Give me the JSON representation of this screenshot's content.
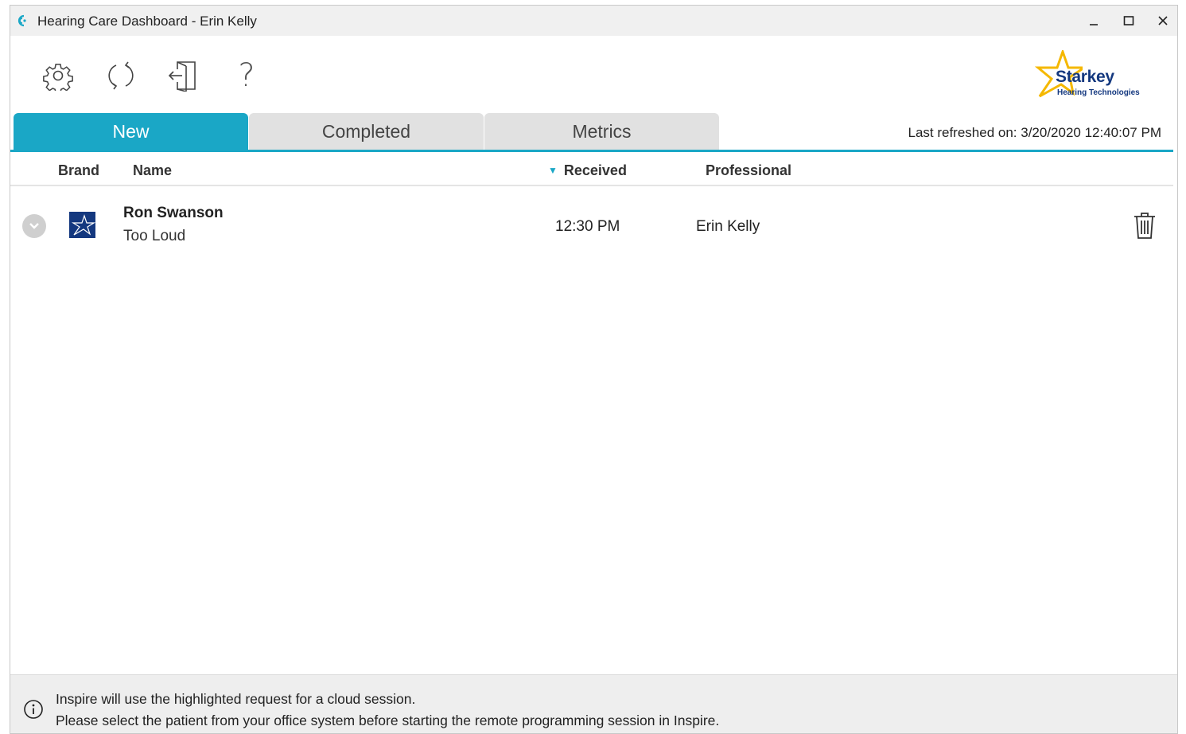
{
  "window": {
    "title": "Hearing Care Dashboard - Erin Kelly",
    "minimize_icon": "minimize-icon",
    "maximize_icon": "maximize-icon",
    "close_icon": "close-icon"
  },
  "toolbar": {
    "icons": [
      "gear-icon",
      "refresh-icon",
      "exit-door-icon",
      "question-mark-icon"
    ],
    "help_label": "?"
  },
  "logo": {
    "name": "Starkey",
    "subtitle": "Hearing Technologies"
  },
  "tabs": [
    {
      "label": "New",
      "active": true
    },
    {
      "label": "Completed",
      "active": false
    },
    {
      "label": "Metrics",
      "active": false
    }
  ],
  "last_refreshed": "Last refreshed on: 3/20/2020 12:40:07 PM",
  "columns": {
    "brand": "Brand",
    "name": "Name",
    "received": "Received",
    "professional": "Professional"
  },
  "rows": [
    {
      "name": "Ron Swanson",
      "issue": "Too Loud",
      "received": "12:30 PM",
      "professional": "Erin Kelly",
      "brand_icon": "starkey-star-icon"
    }
  ],
  "footer": {
    "line1": "Inspire will use the highlighted request for a cloud session.",
    "line2": "Please select the patient from your office system before starting the remote programming session in Inspire."
  },
  "colors": {
    "accent": "#1aa7c6",
    "brand_navy": "#14387f",
    "logo_star": "#f5b800",
    "tab_inactive": "#e1e1e1",
    "footer_bg": "#eeeeee"
  }
}
